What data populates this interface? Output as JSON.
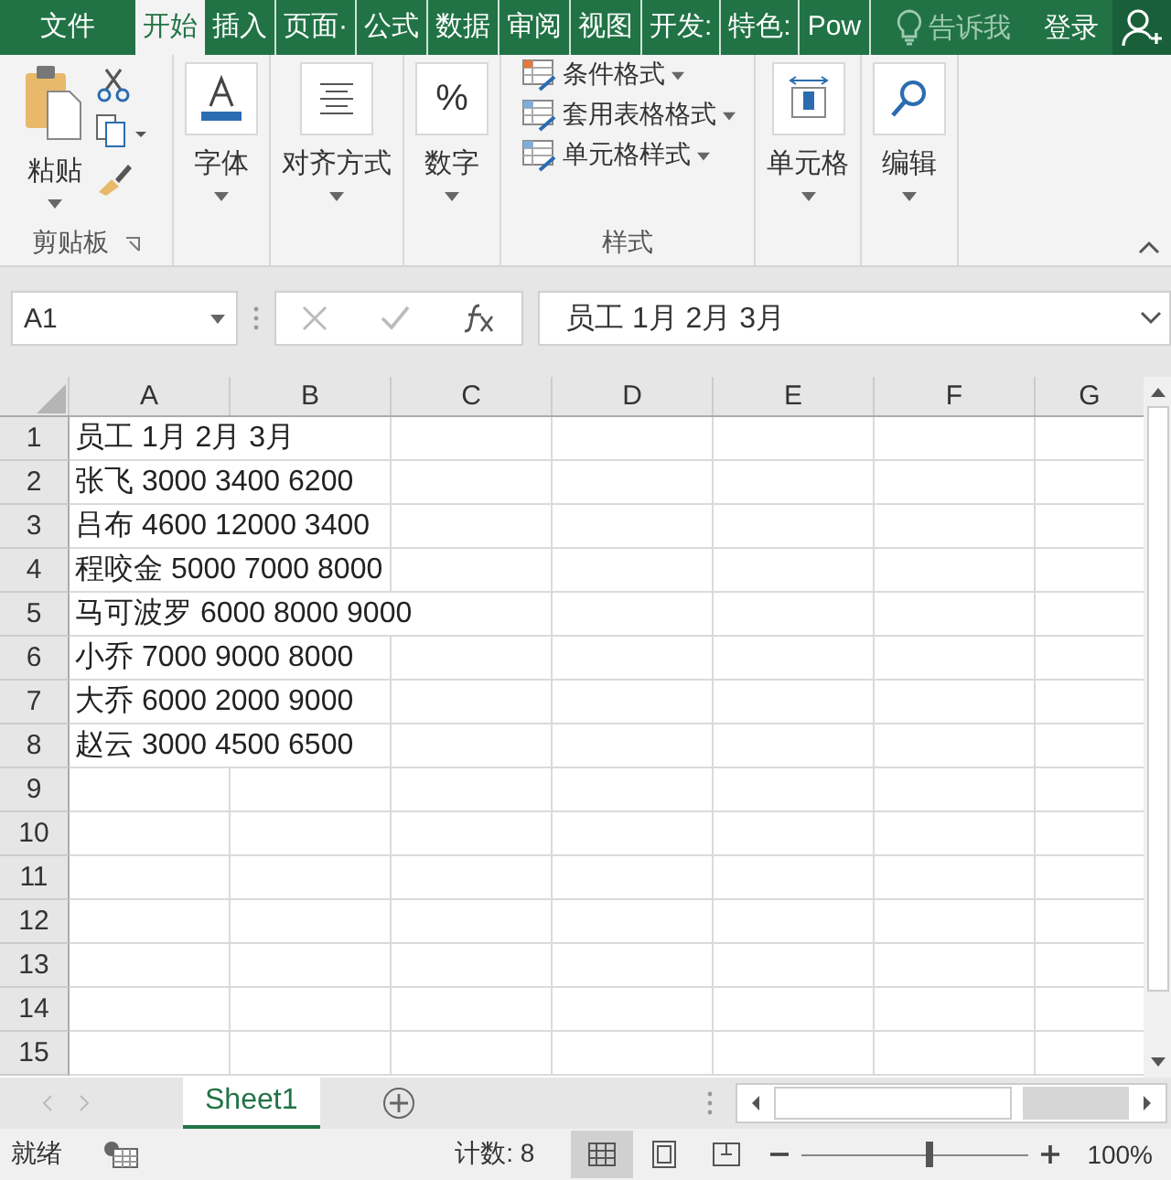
{
  "tabs": [
    {
      "label": "文件",
      "selected": false
    },
    {
      "label": "开始",
      "selected": true
    },
    {
      "label": "插入",
      "selected": false
    },
    {
      "label": "页面·",
      "selected": false
    },
    {
      "label": "公式",
      "selected": false
    },
    {
      "label": "数据",
      "selected": false
    },
    {
      "label": "审阅",
      "selected": false
    },
    {
      "label": "视图",
      "selected": false
    },
    {
      "label": "开发:",
      "selected": false
    },
    {
      "label": "特色:",
      "selected": false
    },
    {
      "label": "Pow",
      "selected": false
    }
  ],
  "tell_me": "告诉我",
  "sign_in": "登录",
  "ribbon": {
    "clipboard": {
      "paste": "粘贴",
      "label": "剪贴板"
    },
    "font": "字体",
    "alignment": "对齐方式",
    "number_icon": "%",
    "number": "数字",
    "styles": {
      "items": [
        "条件格式",
        "套用表格格式",
        "单元格样式"
      ],
      "label": "样式"
    },
    "cells": "单元格",
    "editing": "编辑"
  },
  "name_box": "A1",
  "formula": "员工 1月 2月 3月",
  "columns": [
    "A",
    "B",
    "C",
    "D",
    "E",
    "F",
    "G"
  ],
  "rows": [
    {
      "num": "1",
      "text": "员工 1月 2月 3月"
    },
    {
      "num": "2",
      "text": "张飞 3000 3400 6200"
    },
    {
      "num": "3",
      "text": "吕布 4600 12000 3400"
    },
    {
      "num": "4",
      "text": "程咬金 5000 7000 8000"
    },
    {
      "num": "5",
      "text": "马可波罗 6000 8000 9000"
    },
    {
      "num": "6",
      "text": "小乔 7000 9000 8000"
    },
    {
      "num": "7",
      "text": "大乔 6000 2000 9000"
    },
    {
      "num": "8",
      "text": "赵云 3000 4500 6500"
    },
    {
      "num": "9"
    },
    {
      "num": "10"
    },
    {
      "num": "11"
    },
    {
      "num": "12"
    },
    {
      "num": "13"
    },
    {
      "num": "14"
    },
    {
      "num": "15"
    }
  ],
  "sheets": [
    {
      "label": "Sheet1",
      "selected": true
    }
  ],
  "status": {
    "ready": "就绪",
    "count": "计数: 8",
    "zoom": "100%",
    "zoom_slider": {
      "level": 0.55
    }
  }
}
